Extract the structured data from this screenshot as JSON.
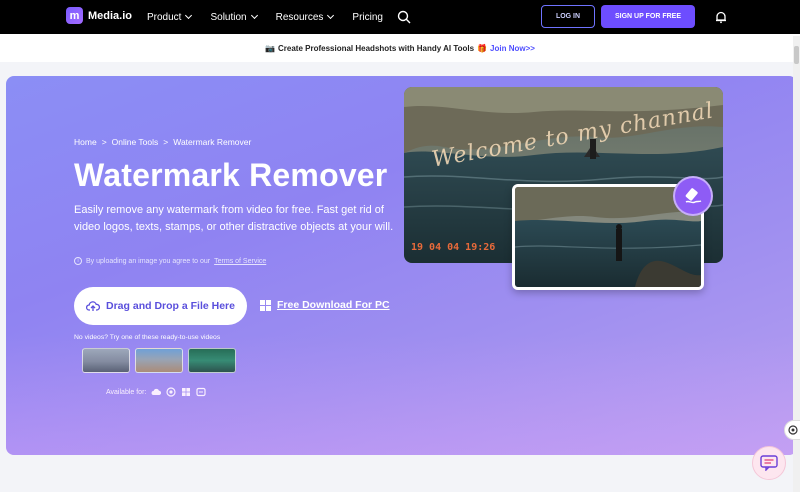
{
  "nav": {
    "logo_mark": "m",
    "logo_text": "Media.io",
    "menu": [
      {
        "label": "Product"
      },
      {
        "label": "Solution"
      },
      {
        "label": "Resources"
      },
      {
        "label": "Pricing"
      }
    ],
    "login_label": "LOG IN",
    "signup_label": "SIGN UP FOR FREE",
    "accent_color": "#6d4dff"
  },
  "promo": {
    "text": "Create Professional Headshots with Handy AI Tools",
    "link": "Join Now>>"
  },
  "hero": {
    "breadcrumb": [
      "Home",
      ">",
      "Online Tools",
      ">",
      "Watermark Remover"
    ],
    "title": "Watermark Remover",
    "description": "Easily remove any watermark from video for free. Fast get rid of video logos, texts, stamps, or other distractive objects at your will.",
    "notice_prefix": "By uploading an image you agree to our",
    "notice_link": "Terms of Service",
    "drop_button": "Drag and Drop a File Here",
    "download_label": "Free Download For PC",
    "try_text": "No videos? Try one of these ready-to-use videos",
    "available_label": "Available for:",
    "watermark_text": "Welcome to my channal",
    "watermark_date": "19 04 04 19:26"
  }
}
